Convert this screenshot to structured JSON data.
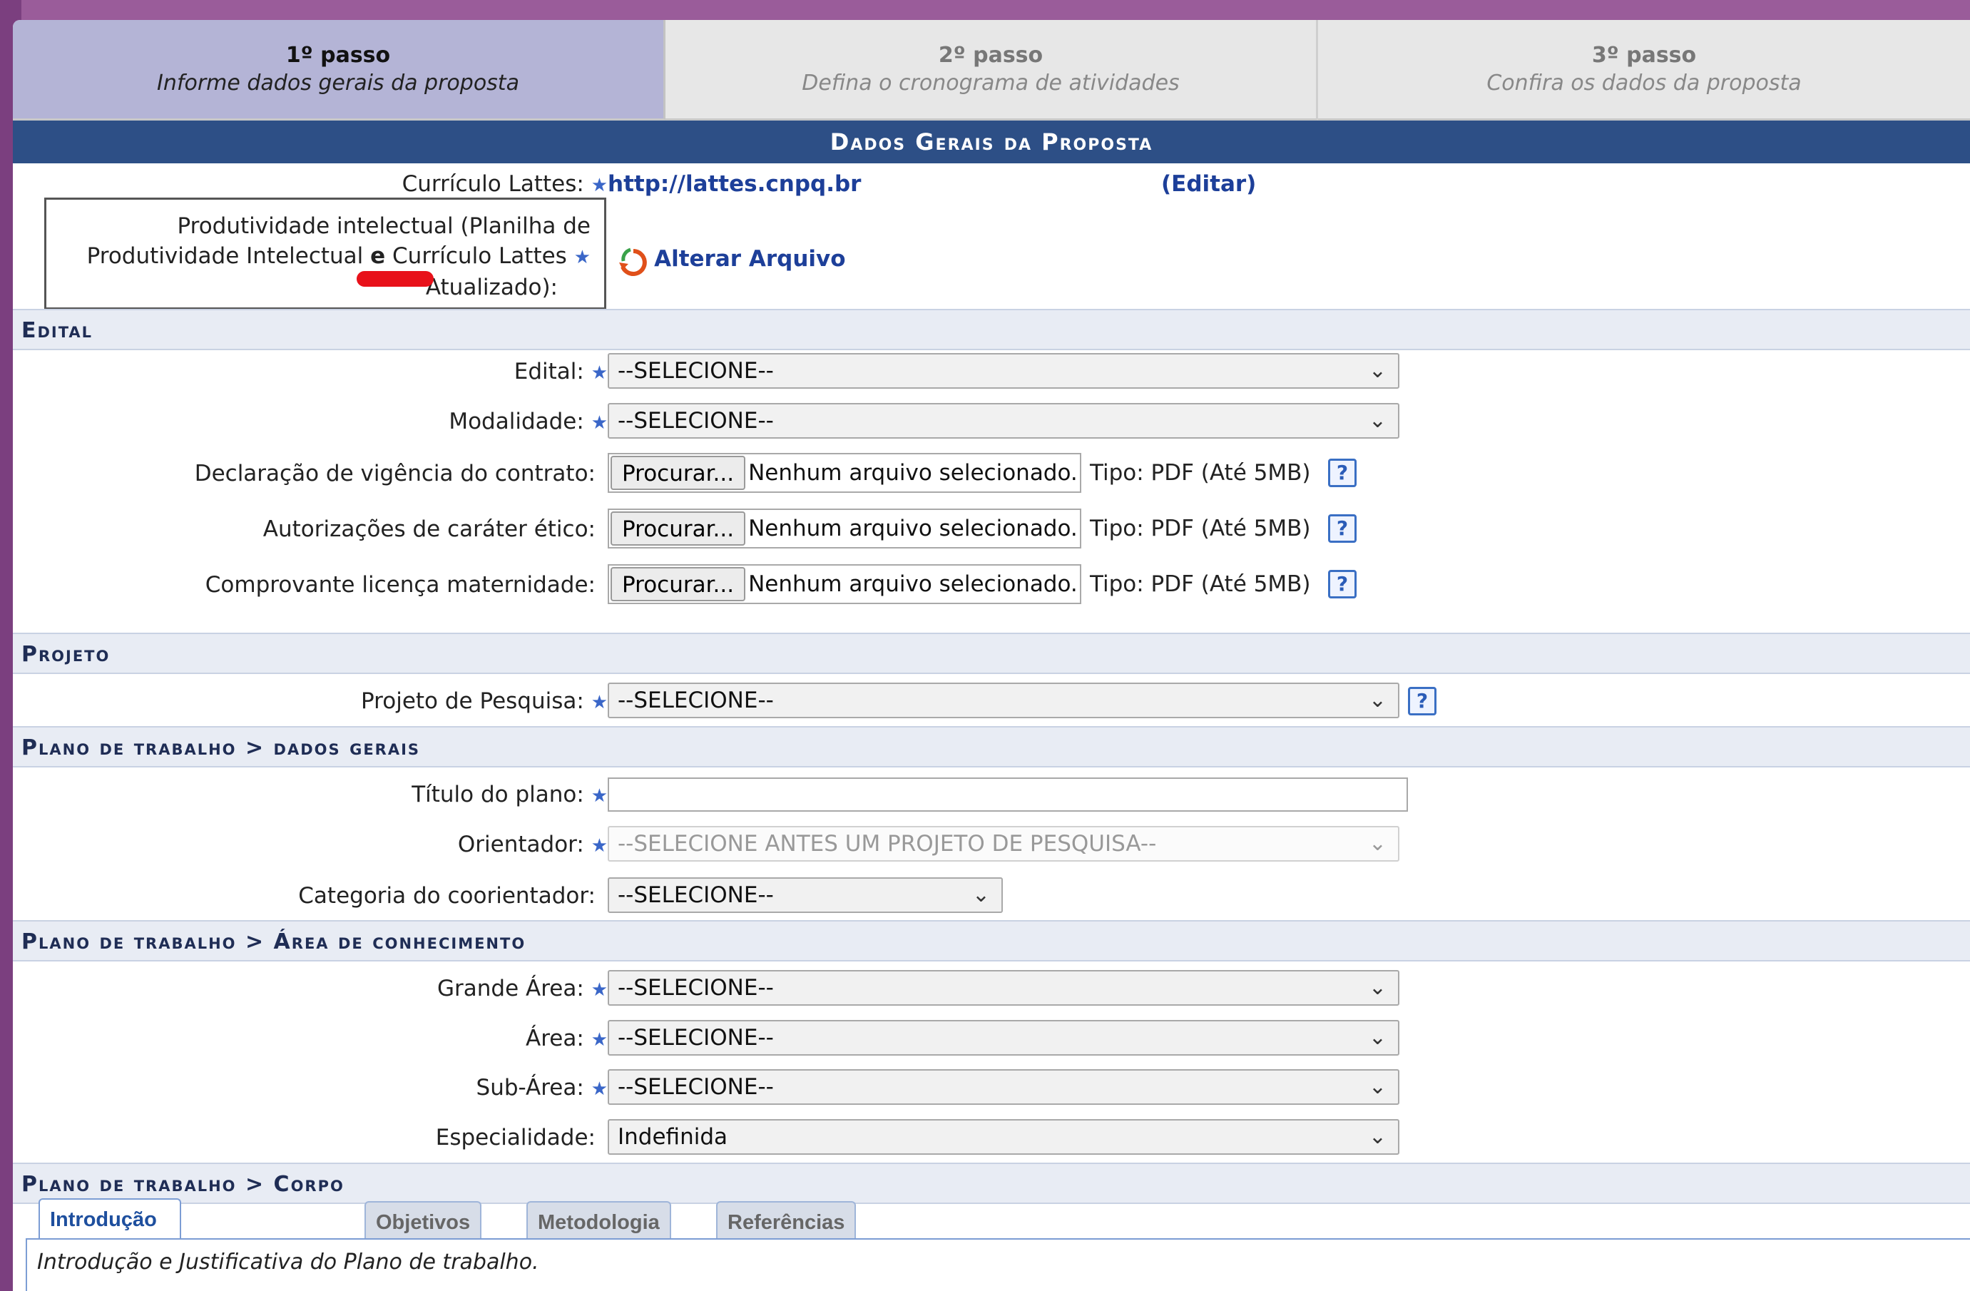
{
  "steps": [
    {
      "num": "1º passo",
      "desc": "Informe dados gerais da proposta"
    },
    {
      "num": "2º passo",
      "desc": "Defina o cronograma de atividades"
    },
    {
      "num": "3º passo",
      "desc": "Confira os dados da proposta"
    }
  ],
  "title": "Dados Gerais da Proposta",
  "lattes": {
    "label": "Currículo Lattes:",
    "url": "http://lattes.cnpq.br",
    "edit": "(Editar)"
  },
  "produtividade": {
    "line1": "Produtividade intelectual (Planilha de",
    "line2a": "Produtividade Intelectual ",
    "line2b": "e",
    "line2c": " Currículo Lattes",
    "line3": "Atualizado):",
    "link": "Alterar Arquivo"
  },
  "sections": {
    "edital": "Edital",
    "projeto": "Projeto",
    "dados_gerais": "Plano de trabalho > dados gerais",
    "area": "Plano de trabalho > Área de conhecimento",
    "corpo": "Plano de trabalho > Corpo"
  },
  "fields": {
    "edital": {
      "label": "Edital:",
      "value": "--SELECIONE--"
    },
    "modalidade": {
      "label": "Modalidade:",
      "value": "--SELECIONE--"
    },
    "declaracao": {
      "label": "Declaração de vigência do contrato:"
    },
    "autorizacoes": {
      "label": "Autorizações de caráter ético:"
    },
    "comprovante": {
      "label": "Comprovante licença maternidade:"
    },
    "projeto": {
      "label": "Projeto de Pesquisa:",
      "value": "--SELECIONE--"
    },
    "titulo": {
      "label": "Título do plano:",
      "value": ""
    },
    "orientador": {
      "label": "Orientador:",
      "value": "--SELECIONE ANTES UM PROJETO DE PESQUISA--"
    },
    "categoria": {
      "label": "Categoria do coorientador:",
      "value": "--SELECIONE--"
    },
    "grande_area": {
      "label": "Grande Área:",
      "value": "--SELECIONE--"
    },
    "area": {
      "label": "Área:",
      "value": "--SELECIONE--"
    },
    "sub_area": {
      "label": "Sub-Área:",
      "value": "--SELECIONE--"
    },
    "especialidade": {
      "label": "Especialidade:",
      "value": "Indefinida"
    }
  },
  "file": {
    "button": "Procurar...",
    "none": "Nenhum arquivo selecionado.",
    "tipo": "Tipo: PDF (Até 5MB)"
  },
  "tabs": [
    "Introdução e Justificativa",
    "Objetivos",
    "Metodologia",
    "Referências"
  ],
  "tab_body": "Introdução e Justificativa do Plano de trabalho.",
  "required_mark": "★",
  "help_glyph": "?"
}
